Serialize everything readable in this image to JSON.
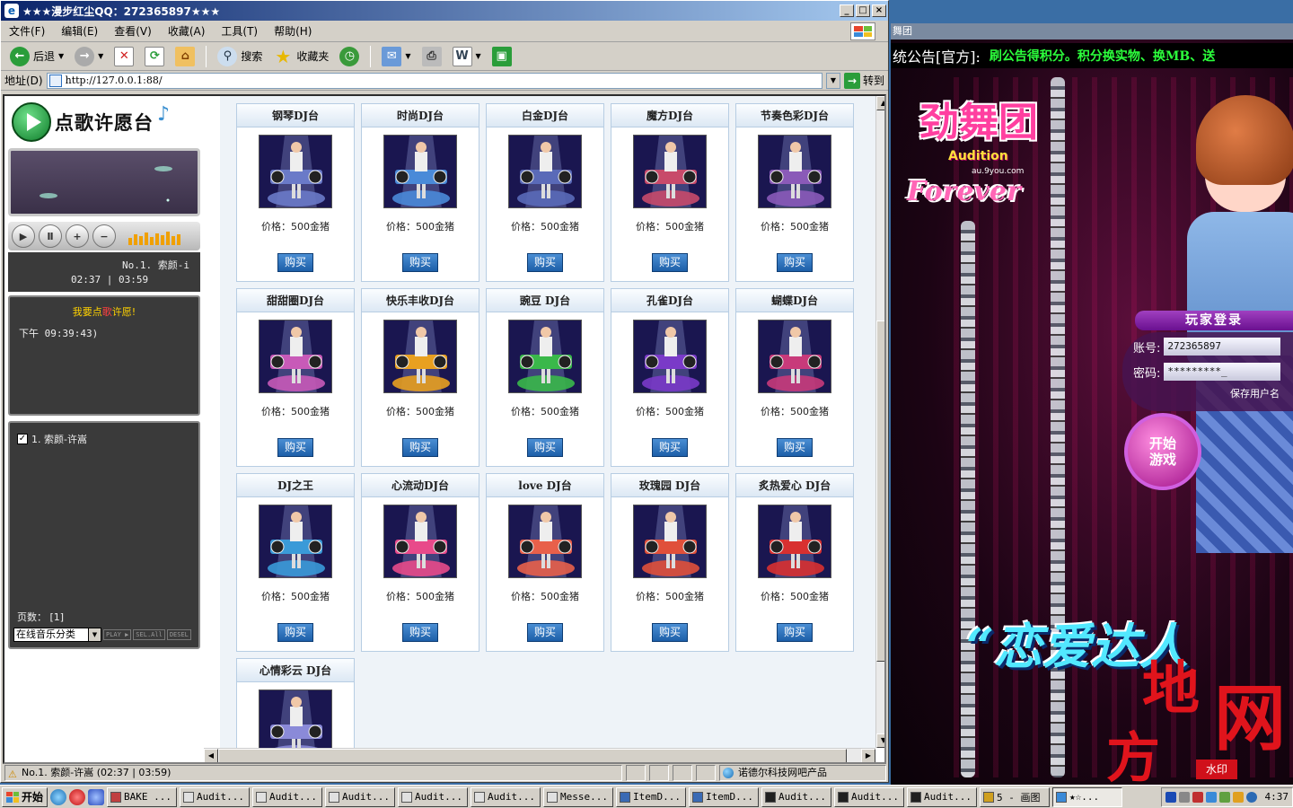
{
  "ie": {
    "title": "★★★漫步红尘QQ：272365897★★★",
    "menu": [
      "文件(F)",
      "编辑(E)",
      "查看(V)",
      "收藏(A)",
      "工具(T)",
      "帮助(H)"
    ],
    "toolbar": {
      "back": "后退",
      "search": "搜索",
      "favorites": "收藏夹"
    },
    "address": {
      "label": "地址(D)",
      "url": "http://127.0.0.1:88/",
      "go": "转到"
    },
    "status": {
      "text": "No.1. 索颜-许嵩 (02:37 | 03:59)",
      "zone": "诺德尔科技网吧产品"
    }
  },
  "player": {
    "logo_text": "点歌许愿台",
    "track": "No.1. 索颜-i",
    "time": "02:37 | 03:59",
    "chat_head_a": "我要点",
    "chat_head_b": "歌",
    "chat_head_c": "许愿!",
    "chat_time": "下午 09:39:43)",
    "playlist_item": "1. 索颜-许嵩",
    "page_label": "页数： [1]",
    "category_select": "在线音乐分类",
    "buttons": [
      "PLAY ▶",
      "SEL.All",
      "DESEL"
    ]
  },
  "shop": {
    "price_label": "价格：500金猪",
    "buy_label": "购买",
    "items": [
      {
        "name": "钢琴DJ台",
        "color": "#6a7ac8"
      },
      {
        "name": "时尚DJ台",
        "color": "#4a8ad8"
      },
      {
        "name": "白金DJ台",
        "color": "#5a6ab8"
      },
      {
        "name": "魔方DJ台",
        "color": "#c84a6a"
      },
      {
        "name": "节奏色彩DJ台",
        "color": "#8a5ab8"
      },
      {
        "name": "甜甜圈DJ台",
        "color": "#c85ab8"
      },
      {
        "name": "快乐丰收DJ台",
        "color": "#e8a020"
      },
      {
        "name": "豌豆 DJ台",
        "color": "#3ab84a"
      },
      {
        "name": "孔雀DJ台",
        "color": "#7a3ac8"
      },
      {
        "name": "蝴蝶DJ台",
        "color": "#c83a7a"
      },
      {
        "name": "DJ之王",
        "color": "#3a9ad8"
      },
      {
        "name": "心流动DJ台",
        "color": "#e84a8a"
      },
      {
        "name": "love DJ台",
        "color": "#e8604a"
      },
      {
        "name": "玫瑰园 DJ台",
        "color": "#e0503a"
      },
      {
        "name": "炙热爱心 DJ台",
        "color": "#d83030"
      },
      {
        "name": "心情彩云 DJ台",
        "color": "#8a8ad8"
      }
    ]
  },
  "game": {
    "window_title": "舞团",
    "ticker_label": "统公告[官方]:",
    "ticker_msg": "刷公告得积分。积分换实物、换MB、送",
    "logo_main": "劲舞团",
    "logo_sub": "Audition",
    "logo_url": "au.9you.com",
    "logo_forever": "Forever",
    "login_title": "玩家登录",
    "account_label": "账号:",
    "account_value": "272365897",
    "password_label": "密码:",
    "password_value": "*********_",
    "save_user": "保存用户名",
    "start_button": "开始\n游戏",
    "slogan": "“恋爱达人",
    "watermark_chars": [
      "地",
      "网",
      "方"
    ],
    "watermark_stamp": "水印"
  },
  "taskbar": {
    "start": "开始",
    "tasks": [
      "BAKE ...",
      "Audit...",
      "Audit...",
      "Audit...",
      "Audit...",
      "Audit...",
      "Messe...",
      "ItemD...",
      "ItemD...",
      "Audit...",
      "Audit...",
      "Audit...",
      "5 - 画图",
      "★☆..."
    ],
    "clock": "4:37"
  }
}
